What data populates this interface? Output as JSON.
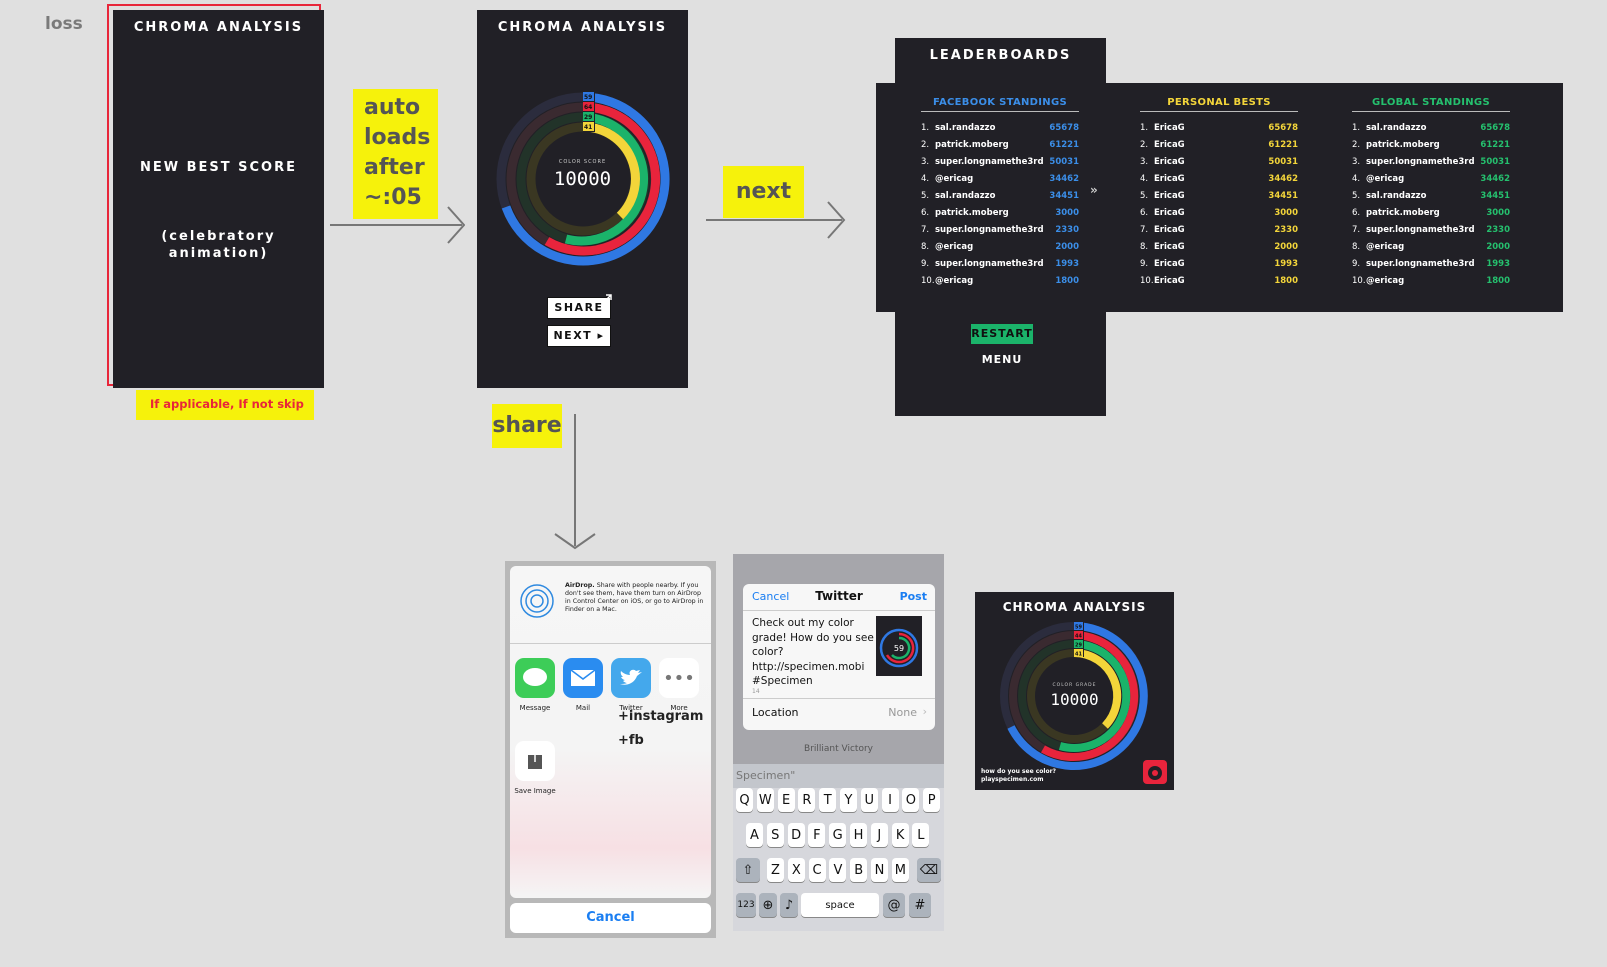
{
  "labels": {
    "loss": "loss",
    "auto_loads": [
      "auto",
      "loads",
      "after",
      "~:05"
    ],
    "next": "next",
    "share": "share",
    "if_applicable": "If applicable, If not skip"
  },
  "screen_loss": {
    "title": "CHROMA ANALYSIS",
    "headline": "NEW BEST SCORE",
    "sub": "(celebratory\nanimation)"
  },
  "screen_score": {
    "title": "CHROMA ANALYSIS",
    "score_label": "COLOR SCORE",
    "score": "10000",
    "ring_labels": [
      "59",
      "64",
      "29",
      "41"
    ],
    "share_btn": "SHARE",
    "next_btn": "NEXT ▸"
  },
  "leaderboards": {
    "title": "LEADERBOARDS",
    "facebook": {
      "heading": "FACEBOOK STANDINGS",
      "rows": [
        {
          "rank": "1.",
          "name": "sal.randazzo",
          "score": "65678"
        },
        {
          "rank": "2.",
          "name": "patrick.moberg",
          "score": "61221"
        },
        {
          "rank": "3.",
          "name": "super.longnamethe3rd",
          "score": "50031"
        },
        {
          "rank": "4.",
          "name": "@ericag",
          "score": "34462"
        },
        {
          "rank": "5.",
          "name": "sal.randazzo",
          "score": "34451"
        },
        {
          "rank": "6.",
          "name": "patrick.moberg",
          "score": "3000"
        },
        {
          "rank": "7.",
          "name": "super.longnamethe3rd",
          "score": "2330"
        },
        {
          "rank": "8.",
          "name": "@ericag",
          "score": "2000"
        },
        {
          "rank": "9.",
          "name": "super.longnamethe3rd",
          "score": "1993"
        },
        {
          "rank": "10.",
          "name": "@ericag",
          "score": "1800"
        }
      ]
    },
    "personal": {
      "heading": "PERSONAL BESTS",
      "rows": [
        {
          "rank": "1.",
          "name": "EricaG",
          "score": "65678"
        },
        {
          "rank": "2.",
          "name": "EricaG",
          "score": "61221"
        },
        {
          "rank": "3.",
          "name": "EricaG",
          "score": "50031"
        },
        {
          "rank": "4.",
          "name": "EricaG",
          "score": "34462"
        },
        {
          "rank": "5.",
          "name": "EricaG",
          "score": "34451"
        },
        {
          "rank": "6.",
          "name": "EricaG",
          "score": "3000"
        },
        {
          "rank": "7.",
          "name": "EricaG",
          "score": "2330"
        },
        {
          "rank": "8.",
          "name": "EricaG",
          "score": "2000"
        },
        {
          "rank": "9.",
          "name": "EricaG",
          "score": "1993"
        },
        {
          "rank": "10.",
          "name": "EricaG",
          "score": "1800"
        }
      ]
    },
    "global": {
      "heading": "GLOBAL STANDINGS",
      "rows": [
        {
          "rank": "1.",
          "name": "sal.randazzo",
          "score": "65678"
        },
        {
          "rank": "2.",
          "name": "patrick.moberg",
          "score": "61221"
        },
        {
          "rank": "3.",
          "name": "super.longnamethe3rd",
          "score": "50031"
        },
        {
          "rank": "4.",
          "name": "@ericag",
          "score": "34462"
        },
        {
          "rank": "5.",
          "name": "sal.randazzo",
          "score": "34451"
        },
        {
          "rank": "6.",
          "name": "patrick.moberg",
          "score": "3000"
        },
        {
          "rank": "7.",
          "name": "super.longnamethe3rd",
          "score": "2330"
        },
        {
          "rank": "8.",
          "name": "@ericag",
          "score": "2000"
        },
        {
          "rank": "9.",
          "name": "super.longnamethe3rd",
          "score": "1993"
        },
        {
          "rank": "10.",
          "name": "@ericag",
          "score": "1800"
        }
      ]
    },
    "chevrons": "»",
    "restart_btn": "RESTART",
    "menu_btn": "MENU"
  },
  "share_sheet": {
    "airdrop_bold": "AirDrop.",
    "airdrop_text": " Share with people nearby. If you don't see them, have them turn on AirDrop in Control Center on iOS, or go to AirDrop in Finder on a Mac.",
    "apps": [
      "Message",
      "Mail",
      "Twitter",
      "More"
    ],
    "save_image": "Save Image",
    "cancel": "Cancel",
    "note_instagram": "+instagram",
    "note_fb": "+fb"
  },
  "twitter": {
    "cancel": "Cancel",
    "title": "Twitter",
    "post": "Post",
    "body": "Check out my color grade! How        do you see color? http://specimen.mobi #Specimen",
    "count": "14",
    "location_label": "Location",
    "location_value": "None",
    "behind_text": "Brilliant Victory",
    "suggestion": "Specimen\"",
    "thumb_score": "59",
    "keyboard": {
      "row1": [
        "Q",
        "W",
        "E",
        "R",
        "T",
        "Y",
        "U",
        "I",
        "O",
        "P"
      ],
      "row2": [
        "A",
        "S",
        "D",
        "F",
        "G",
        "H",
        "J",
        "K",
        "L"
      ],
      "row3": [
        "Z",
        "X",
        "C",
        "V",
        "B",
        "N",
        "M"
      ],
      "num": "123",
      "space": "space",
      "at": "@",
      "hash": "#"
    }
  },
  "share_card": {
    "title": "CHROMA ANALYSIS",
    "score_label": "COLOR GRADE",
    "score": "10000",
    "ring_labels": [
      "59",
      "44",
      "29",
      "41"
    ],
    "footer1": "how do you see color?",
    "footer2": "playspecimen.com"
  },
  "colors": {
    "blue": "#2f78e3",
    "red": "#e8243c",
    "green": "#1bb36a",
    "yellow": "#f3d53a",
    "dark": "#212026",
    "sticky": "#f6f20b",
    "fb_head": "#3b8ee8",
    "pb_head": "#f3d53a",
    "gl_head": "#25c06e"
  }
}
